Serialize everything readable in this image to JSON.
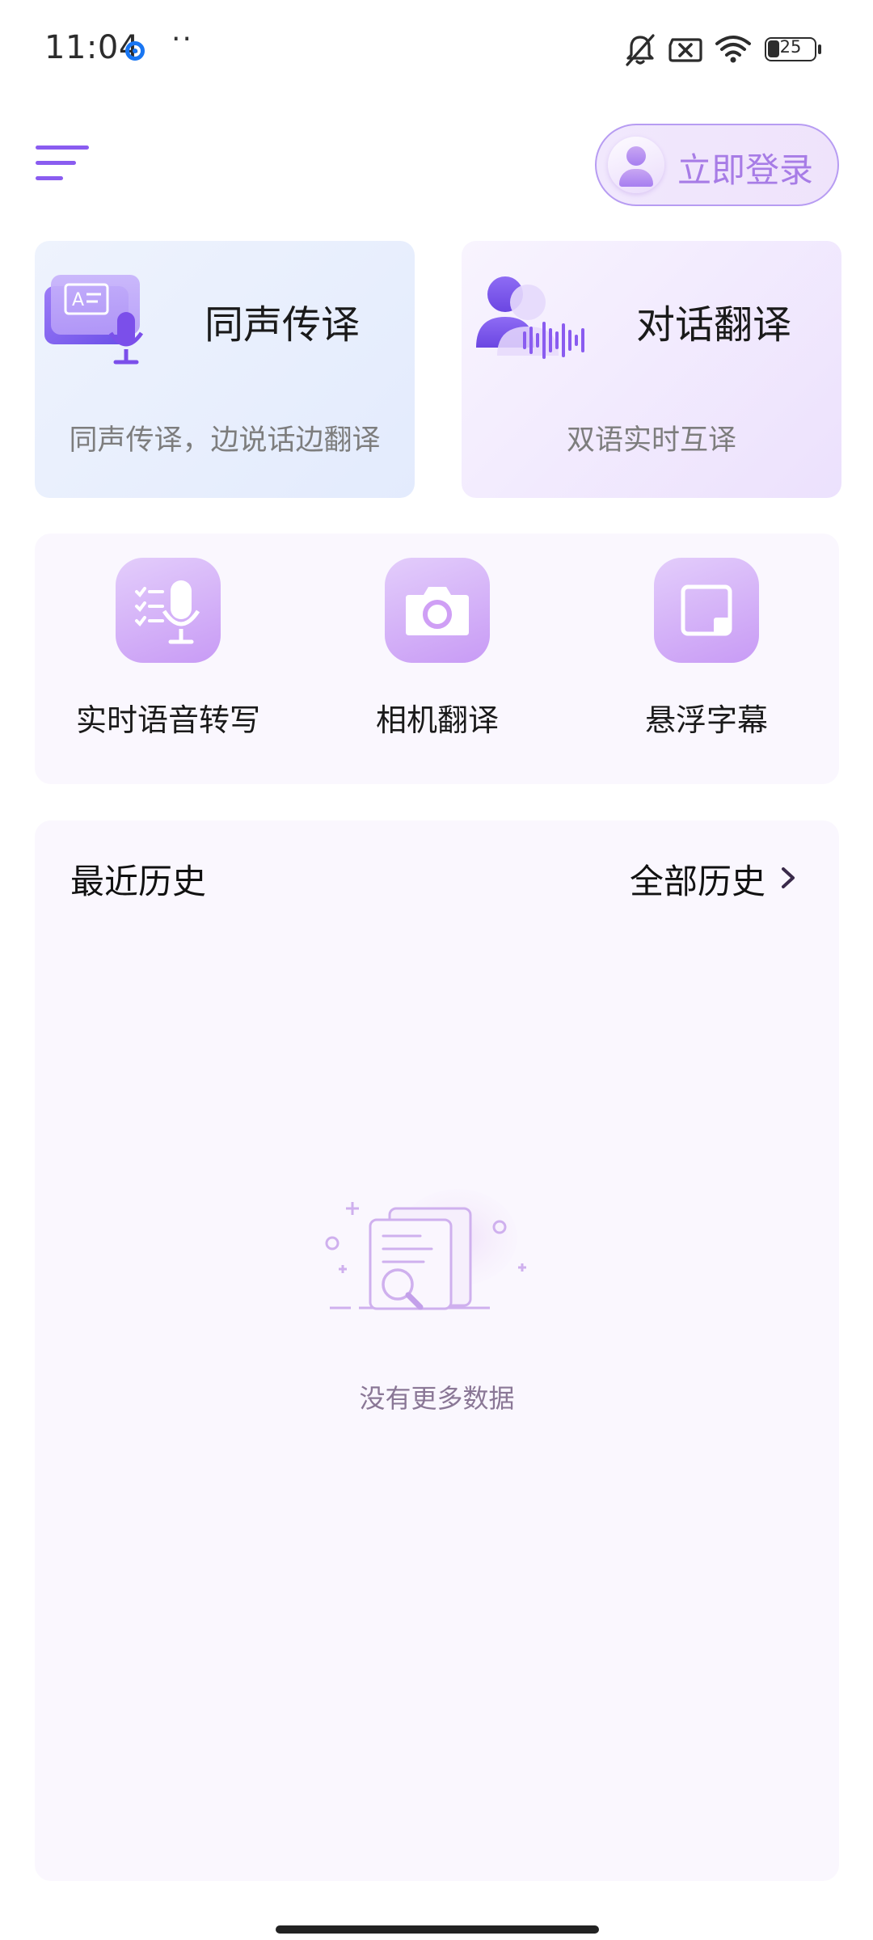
{
  "status_bar": {
    "time": "11:04",
    "more": "··",
    "battery": "25"
  },
  "header": {
    "login_label": "立即登录"
  },
  "cards": [
    {
      "title": "同声传译",
      "subtitle": "同声传译，边说话边翻译"
    },
    {
      "title": "对话翻译",
      "subtitle": "双语实时互译"
    }
  ],
  "tools": [
    {
      "label": "实时语音转写",
      "icon": "mic-transcribe-icon"
    },
    {
      "label": "相机翻译",
      "icon": "camera-icon"
    },
    {
      "label": "悬浮字幕",
      "icon": "floating-window-icon"
    }
  ],
  "history": {
    "title": "最近历史",
    "all_label": "全部历史",
    "empty_text": "没有更多数据"
  },
  "colors": {
    "accent": "#8a5cf0",
    "login_text": "#a77ce6",
    "icon_bg": "#c89bf5",
    "panel_bg": "#faf7fe"
  }
}
